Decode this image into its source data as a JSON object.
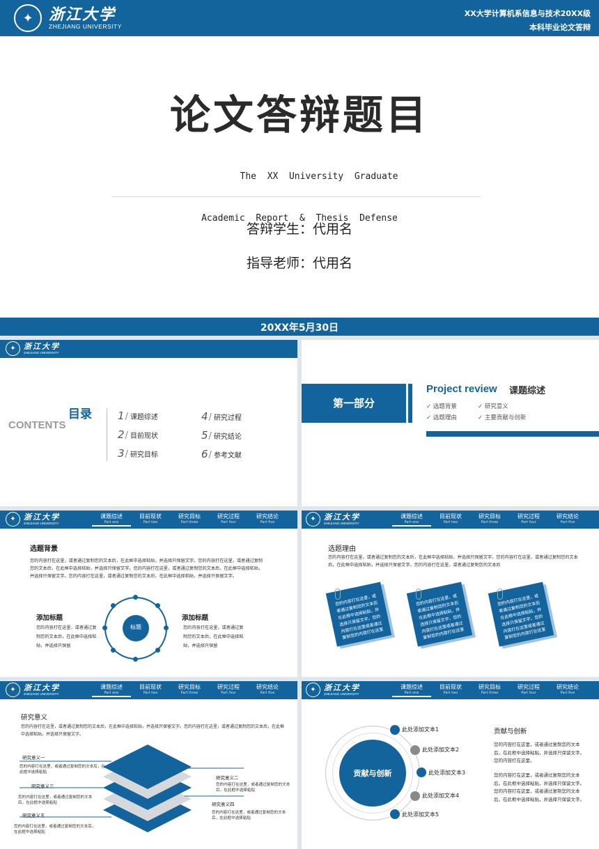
{
  "title_slide": {
    "logo_cn": "浙江大学",
    "logo_en": "ZHEJIANG UNIVERSITY",
    "header_line1": "XX大学计算机系信息与技术20XX级",
    "header_line2": "本科毕业论文答辩",
    "title": "论文答辩题目",
    "subtitle_line1": "The  XX  University  Graduate",
    "subtitle_line2": "Academic  Report  &  Thesis  Defense",
    "student": "答辩学生：代用名",
    "advisor": "指导老师：代用名",
    "date": "20XX年5月30日"
  },
  "small_logo": {
    "cn": "浙江大学",
    "en": "ZHEJIANG UNIVERSITY"
  },
  "nav": [
    {
      "a": "课题综述",
      "b": "Part one"
    },
    {
      "a": "目前现状",
      "b": "Part two"
    },
    {
      "a": "研究目标",
      "b": "Part three"
    },
    {
      "a": "研究过程",
      "b": "Part four"
    },
    {
      "a": "研究结论",
      "b": "Part five"
    }
  ],
  "contents": {
    "label": "目录",
    "en": "CONTENTS",
    "items": [
      {
        "n": "1",
        "t": "课题综述"
      },
      {
        "n": "2",
        "t": "目前现状"
      },
      {
        "n": "3",
        "t": "研究目标"
      },
      {
        "n": "4",
        "t": "研究过程"
      },
      {
        "n": "5",
        "t": "研究结论"
      },
      {
        "n": "6",
        "t": "参考文献"
      }
    ]
  },
  "part1": {
    "box": "第一部分",
    "en": "Project review",
    "cn": "课题综述",
    "items": [
      "选题背景",
      "研究意义",
      "选题理由",
      "主要贡献与创新"
    ]
  },
  "bg_slide": {
    "title": "选题背景",
    "para": "您的内容打在这里，或者通过复制您的文本后，在此框中选择粘贴，并选择只保留文字。您的内容打在这里，或者通过复制您的文本后，在此框中选择粘贴，并选择只保留文字。您的内容打在这里，或者通过复制您的文本后，在此框中选择粘贴，并选择只保留文字。您的内容打在这里，或者通过复制您的文本后，在此框中选择粘贴，并选择只保留文字。",
    "left_title": "添加标题",
    "left_text": "您的内容打在这里，或者通过复制您的文本后，在此框中选择粘贴，并选择只保留",
    "right_title": "添加标题",
    "right_text": "您的内容打在这里，或者通过复制您的文本后，在此框中选择粘贴，并选择只保留",
    "center": "标题"
  },
  "reason_slide": {
    "title": "选题理由",
    "para": "您的内容打在这里，或者通过复制您的文本后，在此框中选择粘贴，并选择只保留文字。您的内容打在这里，或者通过复制您的文本后，在此框中选择粘贴，并选择只保留文字。您的内容打在这里，或者通过复制您的文本后",
    "note": "您的内容打在这里，或者通过复制您的文本后在此框中选择粘贴，并选择只保留文字。您的内容打在这里或者通过复制您的内容打在这里"
  },
  "meaning_slide": {
    "title": "研究意义",
    "para": "您的内容打在这里，或者通过复制您的文本后，在此框中选择粘贴，并选择只保留文字。您的内容打在这里，或者通过复制您的文本后，在此框中选择粘贴，并选择只保留文字。",
    "labels": [
      "研究意义一",
      "研究意义二",
      "研究意义三",
      "研究意义四",
      "研究意义五"
    ],
    "text": "您的内容打在这里，或者通过复制您的文本后，在此框中选择粘贴"
  },
  "innov_slide": {
    "center": "贡献与创新",
    "items": [
      "此处添加文本1",
      "此处添加文本2",
      "此处添加文本3",
      "此处添加文本4",
      "此处添加文本5"
    ],
    "title": "贡献与创新",
    "p1": "您的内容打在这里，或者通过复制您的文本后，在此框中选择粘贴，并选择只保留文字。您的内容打在这里。",
    "p2": "您的内容打在这里，或者通过复制您的文本后，在此框中选择粘贴，并选择只保留文字。您的内容打在这里，或者通过复制您的文本后，在此框中选择粘贴，并选择只保留文字。"
  },
  "colors": {
    "primary": "#13649d",
    "light": "#d6d9dc"
  }
}
